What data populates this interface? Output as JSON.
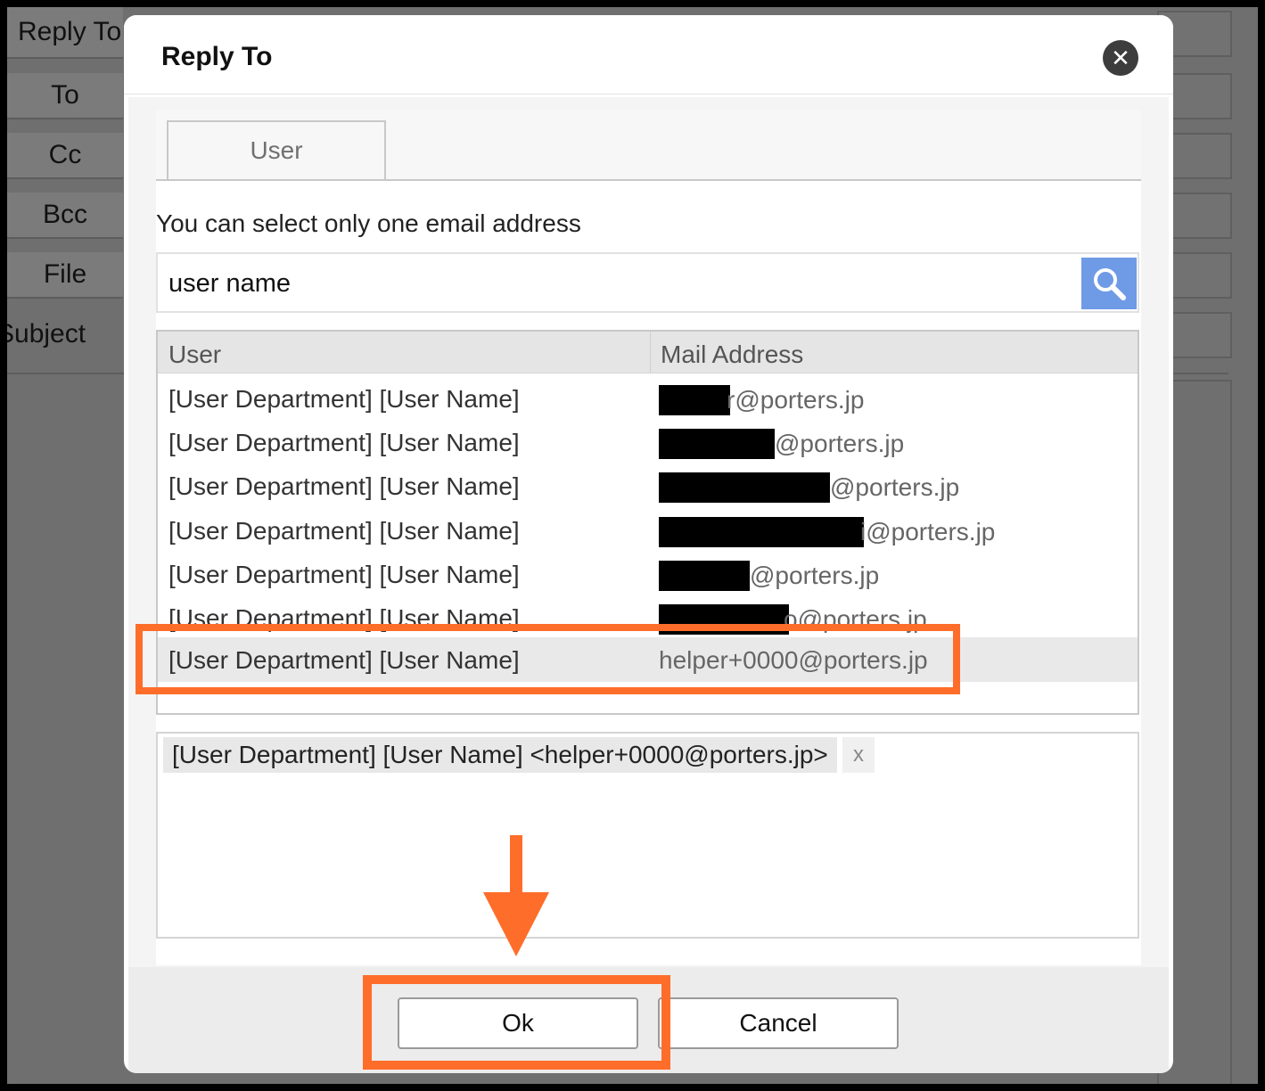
{
  "background_form": {
    "labels": [
      "Reply To",
      "To",
      "Cc",
      "Bcc",
      "File",
      "Subject"
    ]
  },
  "dialog": {
    "title": "Reply To",
    "close_icon": "close-icon",
    "tabs": [
      {
        "label": "User",
        "active": true
      }
    ],
    "hint": "You can select only one email address",
    "search": {
      "value": "user name",
      "icon": "search-icon"
    },
    "table": {
      "headers": {
        "user": "User",
        "mail": "Mail Address"
      },
      "rows": [
        {
          "user": "[User Department] [User Name]",
          "mail_visible": "r@porters.jp",
          "redacted": true
        },
        {
          "user": "[User Department] [User Name]",
          "mail_visible": "@porters.jp",
          "redacted": true
        },
        {
          "user": "[User Department] [User Name]",
          "mail_visible": "@porters.jp",
          "redacted": true
        },
        {
          "user": "[User Department] [User Name]",
          "mail_visible": "i@porters.jp",
          "redacted": true
        },
        {
          "user": "[User Department] [User Name]",
          "mail_visible": "@porters.jp",
          "redacted": true
        },
        {
          "user": "[User Department] [User Name]",
          "mail_visible": "o@porters.jp",
          "redacted": true
        },
        {
          "user": "[User Department] [User Name]",
          "mail_visible": "helper+0000@porters.jp",
          "redacted": false,
          "selected": true
        }
      ]
    },
    "selected_chip": {
      "label": "[User Department] [User Name] <helper+0000@porters.jp>",
      "remove": "x"
    },
    "buttons": {
      "ok": "Ok",
      "cancel": "Cancel"
    }
  },
  "annotations": {
    "highlight_color": "#ff6d2a"
  }
}
